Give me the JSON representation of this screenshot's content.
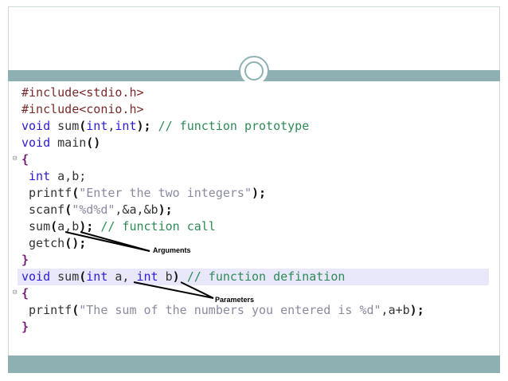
{
  "code_lines": [
    {
      "segments": [
        {
          "t": "#include<stdio.h>",
          "c": "pp"
        }
      ]
    },
    {
      "segments": [
        {
          "t": "#include<conio.h>",
          "c": "pp"
        }
      ]
    },
    {
      "segments": [
        {
          "t": "void",
          "c": "kw"
        },
        {
          "t": " sum",
          "c": "plain"
        },
        {
          "t": "(",
          "c": "pn"
        },
        {
          "t": "int",
          "c": "kw"
        },
        {
          "t": ",",
          "c": "plain"
        },
        {
          "t": "int",
          "c": "kw"
        },
        {
          "t": ")",
          "c": "pn"
        },
        {
          "t": "; ",
          "c": "pn"
        },
        {
          "t": "// function prototype",
          "c": "cm"
        }
      ]
    },
    {
      "segments": [
        {
          "t": "void",
          "c": "kw"
        },
        {
          "t": " main",
          "c": "plain"
        },
        {
          "t": "()",
          "c": "pn"
        }
      ]
    },
    {
      "fold": true,
      "segments": [
        {
          "t": "{",
          "c": "br"
        }
      ]
    },
    {
      "segments": [
        {
          "t": " int",
          "c": "kw"
        },
        {
          "t": " a,b;",
          "c": "plain"
        }
      ]
    },
    {
      "segments": [
        {
          "t": " printf",
          "c": "plain"
        },
        {
          "t": "(",
          "c": "pn"
        },
        {
          "t": "\"Enter the two integers\"",
          "c": "str"
        },
        {
          "t": ");",
          "c": "pn"
        }
      ]
    },
    {
      "segments": [
        {
          "t": " scanf",
          "c": "plain"
        },
        {
          "t": "(",
          "c": "pn"
        },
        {
          "t": "\"%d%d\"",
          "c": "str"
        },
        {
          "t": ",&a,&b",
          "c": "plain"
        },
        {
          "t": ");",
          "c": "pn"
        }
      ]
    },
    {
      "segments": [
        {
          "t": " sum",
          "c": "plain"
        },
        {
          "t": "(",
          "c": "pn"
        },
        {
          "t": "a,b",
          "c": "plain"
        },
        {
          "t": "); ",
          "c": "pn"
        },
        {
          "t": "// function call",
          "c": "cm"
        }
      ]
    },
    {
      "segments": [
        {
          "t": " getch",
          "c": "plain"
        },
        {
          "t": "();",
          "c": "pn"
        }
      ]
    },
    {
      "segments": [
        {
          "t": "}",
          "c": "br"
        }
      ]
    },
    {
      "highlight": true,
      "segments": [
        {
          "t": "void",
          "c": "kw"
        },
        {
          "t": " sum",
          "c": "plain"
        },
        {
          "t": "(",
          "c": "pn"
        },
        {
          "t": "int",
          "c": "kw"
        },
        {
          "t": " a, ",
          "c": "plain"
        },
        {
          "t": "int",
          "c": "kw"
        },
        {
          "t": " b",
          "c": "plain"
        },
        {
          "t": ") ",
          "c": "pn"
        },
        {
          "t": "// function defination",
          "c": "cm"
        }
      ]
    },
    {
      "fold": true,
      "segments": [
        {
          "t": "{",
          "c": "br"
        }
      ]
    },
    {
      "segments": [
        {
          "t": " printf",
          "c": "plain"
        },
        {
          "t": "(",
          "c": "pn"
        },
        {
          "t": "\"The sum of the numbers you entered is %d\"",
          "c": "str"
        },
        {
          "t": ",a+b",
          "c": "plain"
        },
        {
          "t": ");",
          "c": "pn"
        }
      ]
    },
    {
      "segments": [
        {
          "t": "}",
          "c": "br"
        }
      ]
    }
  ],
  "annotations": {
    "arguments_label": "Arguments",
    "parameters_label": "Parameters"
  },
  "colors": {
    "band": "#8fb0b3",
    "highlight": "#e8e8fa",
    "keyword": "#2b1bd6",
    "comment": "#2e8b57",
    "string": "#8a8aa0"
  }
}
